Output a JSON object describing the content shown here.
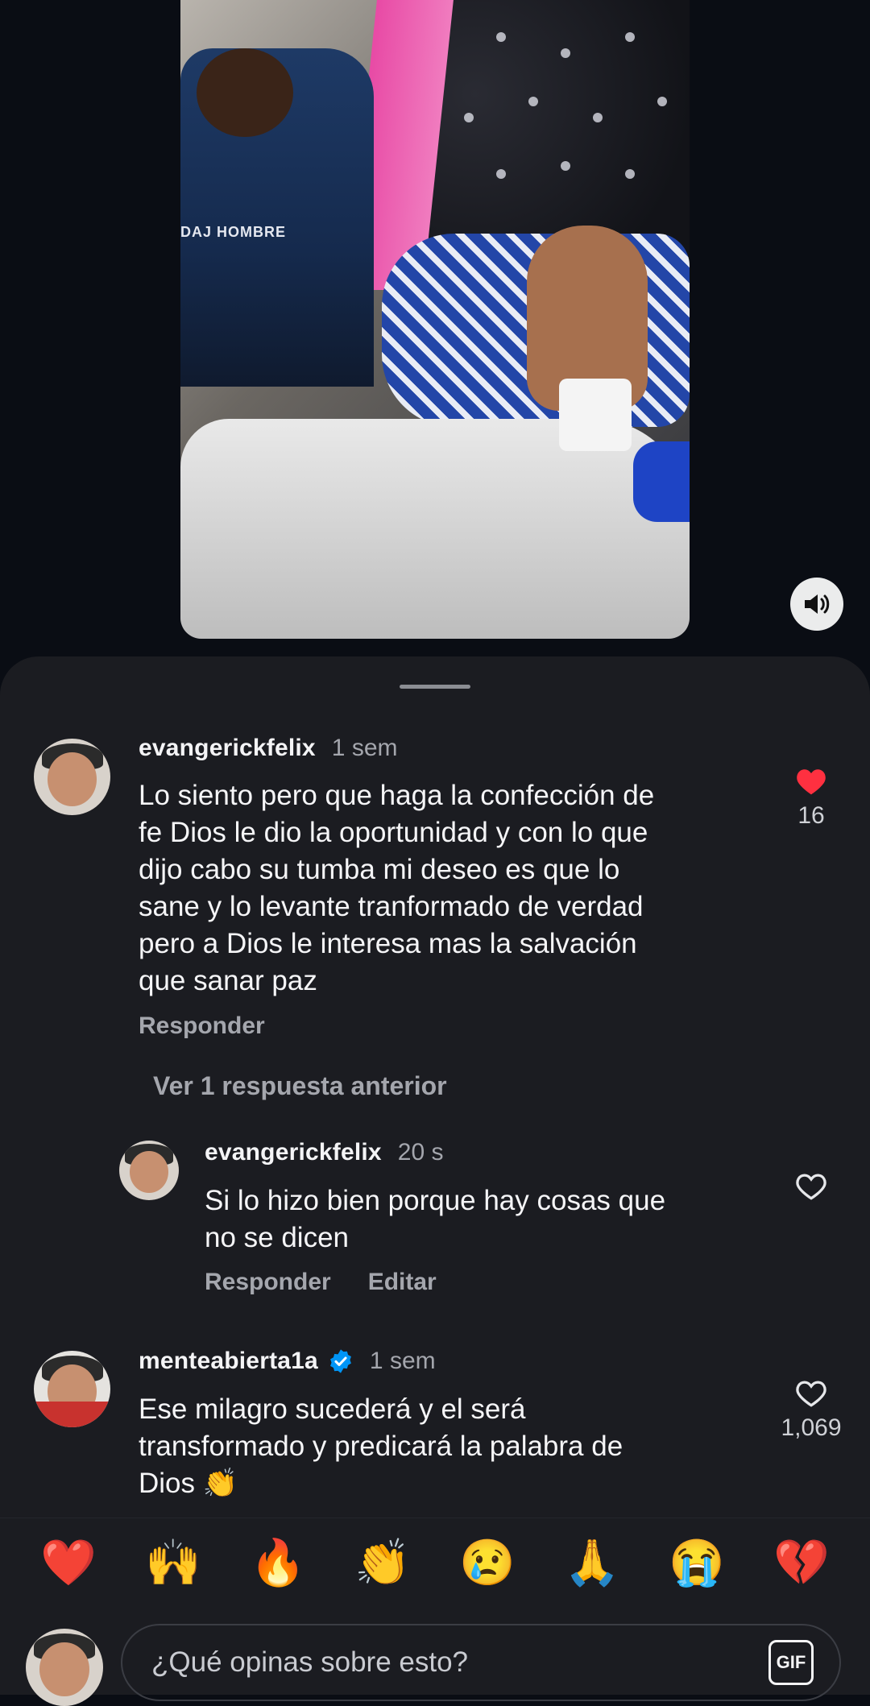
{
  "video": {
    "overlay_text": "DAJ HOMBRE"
  },
  "comments": [
    {
      "username": "evangerickfelix",
      "time": "1 sem",
      "text": "Lo siento pero que haga la confección de fe Dios le dio la oportunidad y con lo que dijo cabo su tumba mi deseo es que lo sane y lo levante tranformado de verdad pero a Dios le interesa mas la salvación que sanar paz",
      "lines": [
        "Lo siento pero que haga la confección de",
        "fe Dios le dio la oportunidad y con lo que",
        "dijo cabo su tumba mi deseo es que lo",
        "sane y lo levante tranformado de verdad",
        "pero a Dios le interesa mas la salvación",
        "que sanar paz"
      ],
      "reply_label": "Responder",
      "likes": "16",
      "liked": true
    },
    {
      "username": "evangerickfelix",
      "time": "20 s",
      "lines": [
        "Si lo hizo bien porque hay cosas que",
        "no se dicen"
      ],
      "reply_label": "Responder",
      "edit_label": "Editar",
      "likes": "",
      "liked": false
    },
    {
      "username": "menteabierta1a",
      "time": "1 sem",
      "verified": true,
      "lines": [
        "Ese milagro  sucederá  y el será",
        "transformado y predicará la palabra de",
        "Dios 👏"
      ],
      "likes": "1,069",
      "liked": false
    }
  ],
  "view_previous_replies": "Ver 1 respuesta anterior",
  "emoji_bar": [
    "❤️",
    "🙌",
    "🔥",
    "👏",
    "😢",
    "🙏",
    "😭",
    "💔"
  ],
  "composer": {
    "placeholder": "¿Qué opinas sobre esto?",
    "gif_label": "GIF"
  },
  "colors": {
    "background": "#0a0d14",
    "sheet": "#1b1c21",
    "like_red": "#ff3040",
    "verified_blue": "#0095f6",
    "muted_text": "#a4a6ad"
  }
}
